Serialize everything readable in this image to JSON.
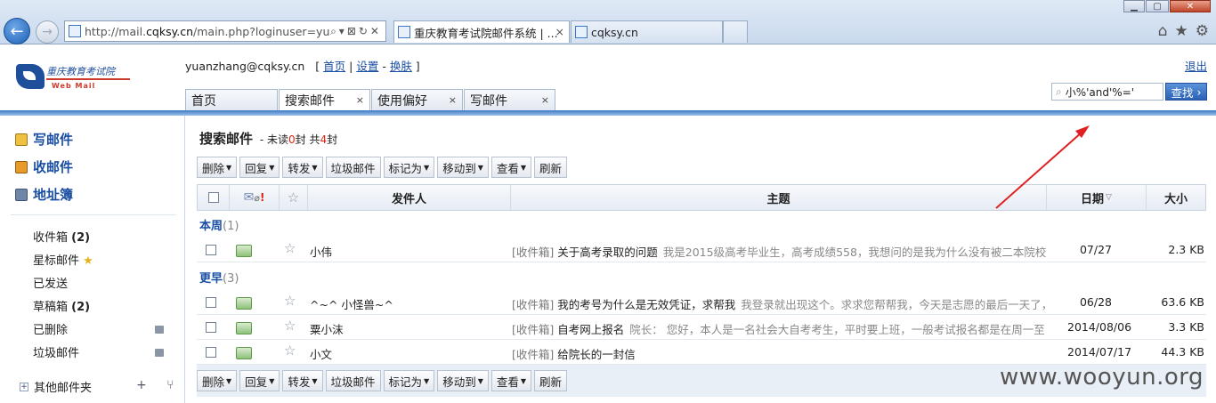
{
  "browser": {
    "url_prefix": "http://mail.",
    "url_domain": "cqksy.cn",
    "url_rest": "/main.php?loginuser=yu",
    "tabs": [
      {
        "label": "重庆教育考试院邮件系统 | ...",
        "active": true
      },
      {
        "label": "cqksy.cn",
        "active": false
      }
    ],
    "close_glyph": "×"
  },
  "header": {
    "logo_text": "重庆教育考试院",
    "logo_sub": "Web   Mail",
    "user": "yuanzhang@cqksy.cn",
    "links": [
      "首页",
      "设置",
      "换肤"
    ],
    "logout": "退出",
    "search_value": "小%'and'%='",
    "search_button": "查找",
    "tabs": [
      {
        "label": "首页",
        "closable": false
      },
      {
        "label": "搜索邮件",
        "closable": true,
        "active": true
      },
      {
        "label": "使用偏好",
        "closable": true
      },
      {
        "label": "写邮件",
        "closable": true
      }
    ]
  },
  "sidebar": {
    "quick": [
      "写邮件",
      "收邮件",
      "地址簿"
    ],
    "folders": [
      {
        "name": "收件箱",
        "count": "(2)"
      },
      {
        "name": "星标邮件",
        "count": ""
      },
      {
        "name": "已发送",
        "count": ""
      },
      {
        "name": "草稿箱",
        "count": "(2)"
      },
      {
        "name": "已删除",
        "count": ""
      },
      {
        "name": "垃圾邮件",
        "count": ""
      }
    ],
    "other_folders": "其他邮件夹",
    "other_ctl": "+ ⑂"
  },
  "main": {
    "title": "搜索邮件",
    "summary_pre": "- 未读",
    "unread": "0",
    "summary_mid": "封 共",
    "total": "4",
    "summary_post": "封",
    "toolbar": [
      {
        "label": "删除",
        "dropdown": true
      },
      {
        "label": "回复",
        "dropdown": true
      },
      {
        "label": "转发",
        "dropdown": true
      },
      {
        "label": "垃圾邮件",
        "dropdown": false
      },
      {
        "label": "标记为",
        "dropdown": true
      },
      {
        "label": "移动到",
        "dropdown": true
      },
      {
        "label": "查看",
        "dropdown": true
      },
      {
        "label": "刷新",
        "dropdown": false
      }
    ],
    "columns": {
      "sender": "发件人",
      "subject": "主题",
      "date": "日期",
      "size": "大小"
    },
    "groups": [
      {
        "label": "本周",
        "count": "(1)"
      },
      {
        "label": "更早",
        "count": "(3)"
      }
    ],
    "rows": [
      {
        "sender": "小伟",
        "folder": "[收件箱]",
        "subject": "关于高考录取的问题",
        "preview": "我是2015级高考毕业生，高考成绩558，我想问的是我为什么没有被二本院校提",
        "date": "07/27",
        "size": "2.3 KB"
      },
      {
        "sender": "^~^ 小怪兽~^",
        "folder": "[收件箱]",
        "subject": "我的考号为什么是无效凭证，求帮我",
        "preview": "我登录就出现这个。求求您帮帮我，今天是志愿的最后一天了，",
        "date": "06/28",
        "size": "63.6 KB"
      },
      {
        "sender": "粟小沫",
        "folder": "[收件箱]",
        "subject": "自考网上报名",
        "preview": "院长：  您好，本人是一名社会大自考考生，平时要上班，一般考试报名都是在周一至",
        "date": "2014/08/06",
        "size": "3.3 KB"
      },
      {
        "sender": "小文",
        "folder": "[收件箱]",
        "subject": "给院长的一封信",
        "preview": "",
        "date": "2014/07/17",
        "size": "44.3 KB"
      }
    ]
  },
  "watermark": "www.wooyun.org",
  "colors": {
    "accent": "#1a4ea3",
    "unread_red": "#dd2211",
    "annotation_arrow": "#e02020"
  }
}
